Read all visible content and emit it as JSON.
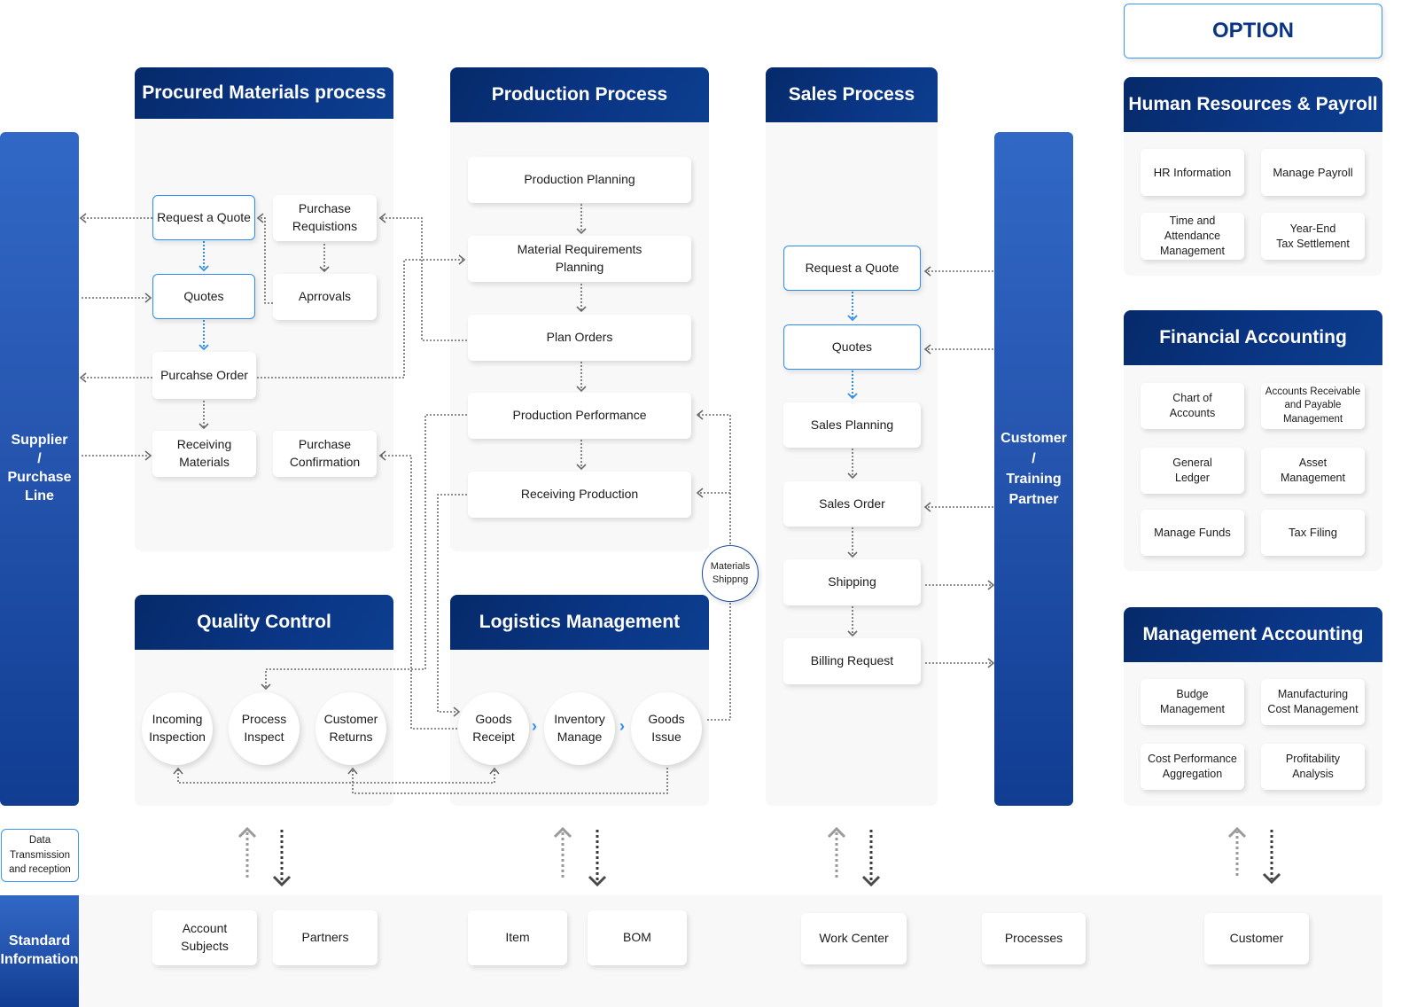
{
  "option_label": "OPTION",
  "side": {
    "supplier": "Supplier\n/\nPurchase\nLine",
    "customer": "Customer\n/\nTraining\nPartner",
    "standard": "Standard\nInformation",
    "data_transmission": "Data\nTransmission\nand reception"
  },
  "procured": {
    "title": "Procured Materials process",
    "items": {
      "request_quote": "Request a Quote",
      "purchase_requisitions": "Purchase\nRequistions",
      "quotes": "Quotes",
      "approvals": "Aprrovals",
      "purchase_order": "Purcahse Order",
      "receiving_materials": "Receiving\nMaterials",
      "purchase_confirmation": "Purchase\nConfirmation"
    }
  },
  "production": {
    "title": "Production Process",
    "items": {
      "planning": "Production Planning",
      "mrp": "Material Requirements\nPlanning",
      "plan_orders": "Plan Orders",
      "performance": "Production Performance",
      "receiving": "Receiving Production"
    }
  },
  "materials_shipping": "Materials\nShippng",
  "sales": {
    "title": "Sales Process",
    "items": {
      "request_quote": "Request a Quote",
      "quotes": "Quotes",
      "planning": "Sales Planning",
      "order": "Sales Order",
      "shipping": "Shipping",
      "billing": "Billing Request"
    }
  },
  "quality": {
    "title": "Quality Control",
    "items": {
      "incoming": "Incoming\nInspection",
      "process": "Process\nInspect",
      "returns": "Customer\nReturns"
    }
  },
  "logistics": {
    "title": "Logistics Management",
    "items": {
      "receipt": "Goods\nReceipt",
      "inventory": "Inventory\nManage",
      "issue": "Goods\nIssue"
    },
    "arrow_glyph": "›"
  },
  "hr": {
    "title": "Human Resources & Payroll",
    "items": [
      "HR Information",
      "Manage Payroll",
      "Time and\nAttendance\nManagement",
      "Year-End\nTax Settlement"
    ]
  },
  "financial": {
    "title": "Financial Accounting",
    "items": [
      "Chart of\nAccounts",
      "Accounts Receivable\nand Payable\nManagement",
      "General\nLedger",
      "Asset\nManagement",
      "Manage Funds",
      "Tax Filing"
    ]
  },
  "management": {
    "title": "Management Accounting",
    "items": [
      "Budge\nManagement",
      "Manufacturing\nCost Management",
      "Cost Performance\nAggregation",
      "Profitability\nAnalysis"
    ]
  },
  "standard_items": [
    "Account\nSubjects",
    "Partners",
    "Item",
    "BOM",
    "Work Center",
    "Processes",
    "Customer"
  ],
  "colors": {
    "header_navy": "#0a3584",
    "side_blue": "#2656b0",
    "highlight_blue": "#2b8ef0",
    "panel_bg": "#f8f8f8"
  }
}
